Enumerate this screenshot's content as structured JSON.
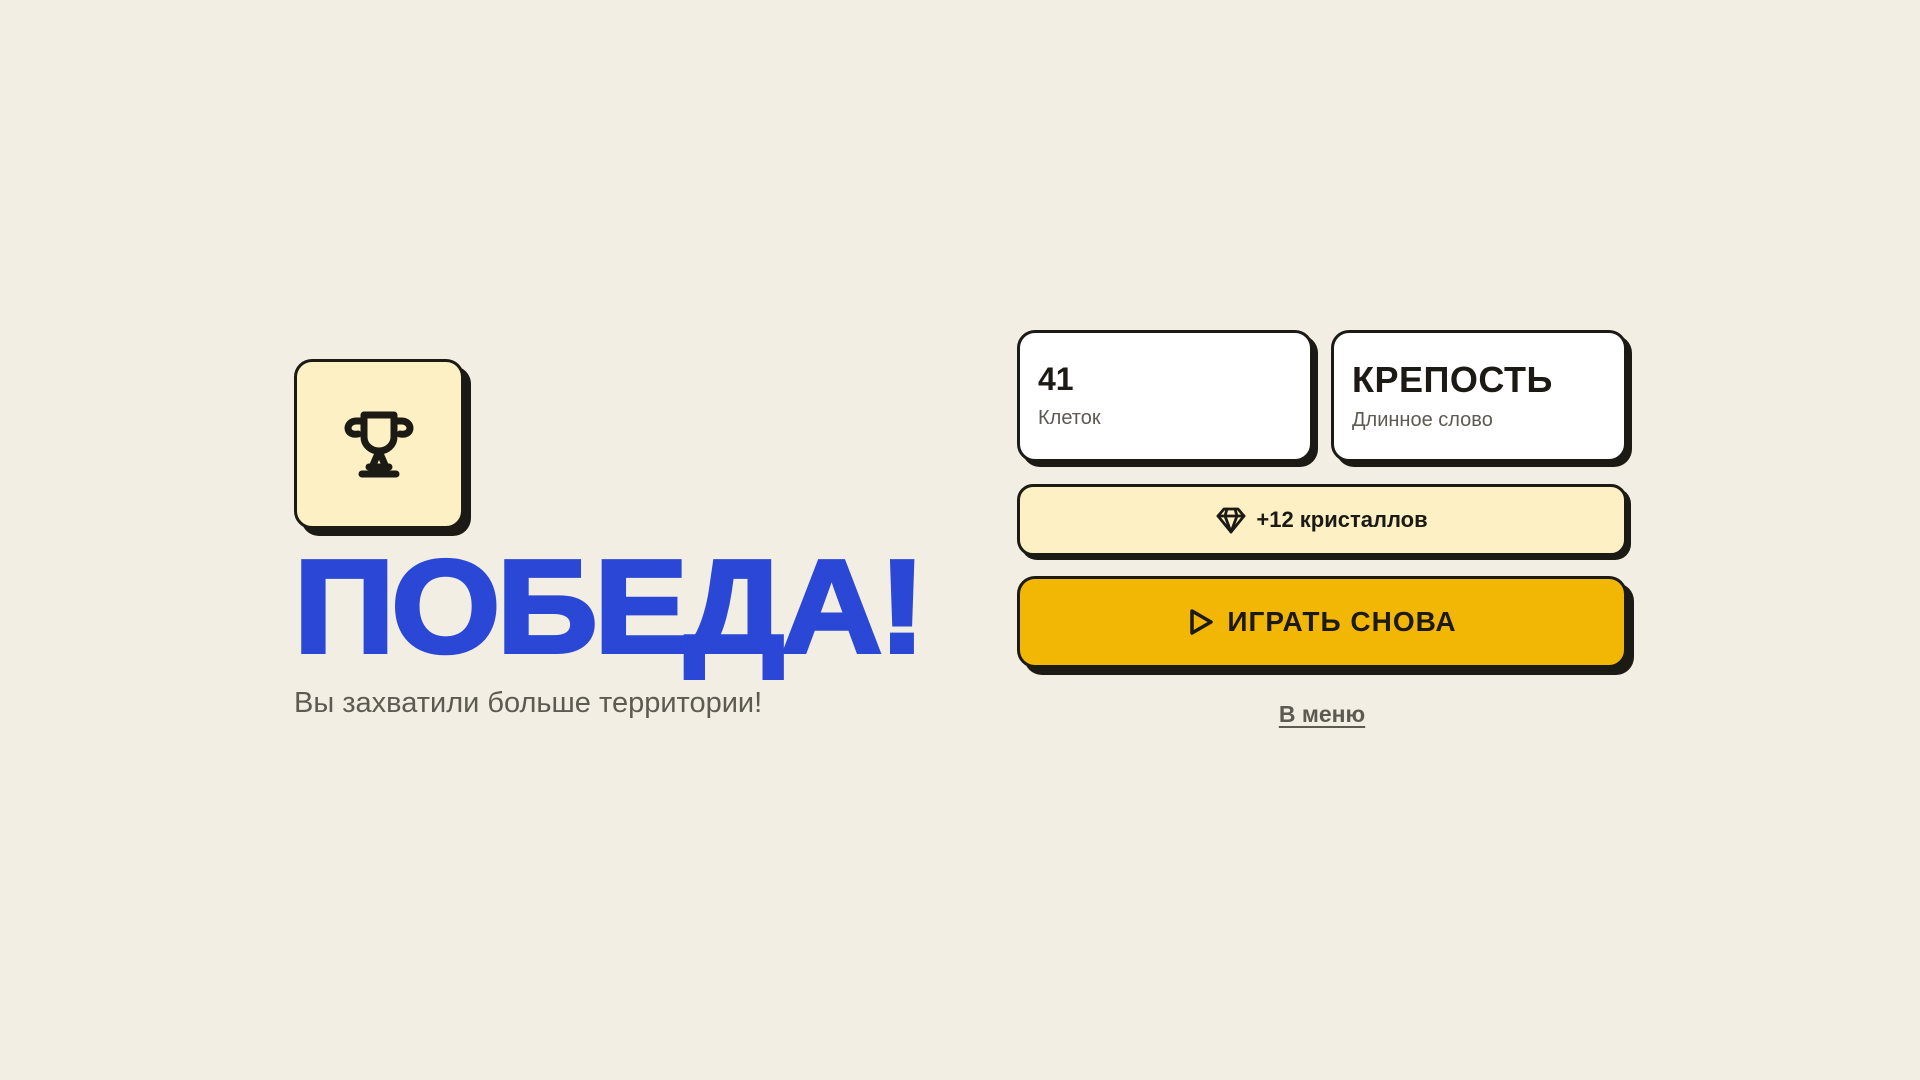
{
  "colors": {
    "background": "#f2eee3",
    "title": "#2b47d6",
    "accent_button": "#f2b705",
    "tile": "#fcf0c4",
    "ink": "#1c1a14",
    "muted": "#5d5a52"
  },
  "result": {
    "icon": "trophy-icon",
    "title": "ПОБЕДА!",
    "subtitle": "Вы захватили больше территории!"
  },
  "stats": [
    {
      "value": "41",
      "label": "Клеток"
    },
    {
      "value": "КРЕПОСТЬ",
      "label": "Длинное слово"
    }
  ],
  "reward": {
    "icon": "gem-icon",
    "text": "+12 кристаллов"
  },
  "actions": {
    "play_again": {
      "icon": "play-icon",
      "label": "ИГРАТЬ СНОВА"
    },
    "menu_link": "В меню"
  }
}
